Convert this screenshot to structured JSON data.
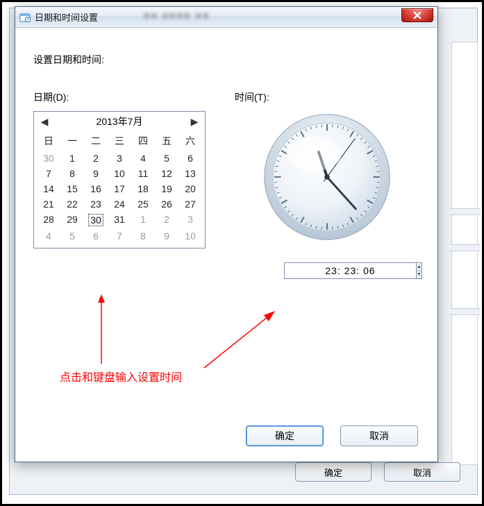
{
  "bgWindow": {
    "ok": "确定",
    "cancel": "取消"
  },
  "dialog": {
    "title": "日期和时间设置",
    "heading": "设置日期和时间:",
    "dateLabel": "日期(D):",
    "timeLabel": "时间(T):",
    "ok": "确定",
    "cancel": "取消"
  },
  "calendar": {
    "monthTitle": "2013年7月",
    "dow": [
      "日",
      "一",
      "二",
      "三",
      "四",
      "五",
      "六"
    ],
    "days": [
      {
        "n": "30",
        "other": true
      },
      {
        "n": "1"
      },
      {
        "n": "2"
      },
      {
        "n": "3"
      },
      {
        "n": "4"
      },
      {
        "n": "5"
      },
      {
        "n": "6"
      },
      {
        "n": "7"
      },
      {
        "n": "8"
      },
      {
        "n": "9"
      },
      {
        "n": "10"
      },
      {
        "n": "11"
      },
      {
        "n": "12"
      },
      {
        "n": "13"
      },
      {
        "n": "14"
      },
      {
        "n": "15"
      },
      {
        "n": "16"
      },
      {
        "n": "17"
      },
      {
        "n": "18"
      },
      {
        "n": "19"
      },
      {
        "n": "20"
      },
      {
        "n": "21"
      },
      {
        "n": "22"
      },
      {
        "n": "23"
      },
      {
        "n": "24"
      },
      {
        "n": "25"
      },
      {
        "n": "26"
      },
      {
        "n": "27"
      },
      {
        "n": "28"
      },
      {
        "n": "29"
      },
      {
        "n": "30",
        "sel": true
      },
      {
        "n": "31"
      },
      {
        "n": "1",
        "other": true
      },
      {
        "n": "2",
        "other": true
      },
      {
        "n": "3",
        "other": true
      },
      {
        "n": "4",
        "other": true
      },
      {
        "n": "5",
        "other": true
      },
      {
        "n": "6",
        "other": true
      },
      {
        "n": "7",
        "other": true
      },
      {
        "n": "8",
        "other": true
      },
      {
        "n": "9",
        "other": true
      },
      {
        "n": "10",
        "other": true
      }
    ]
  },
  "time": {
    "value": "23: 23: 06",
    "hour": 23,
    "minute": 23,
    "second": 6
  },
  "annotation": {
    "text": "点击和键盘输入设置时间"
  }
}
